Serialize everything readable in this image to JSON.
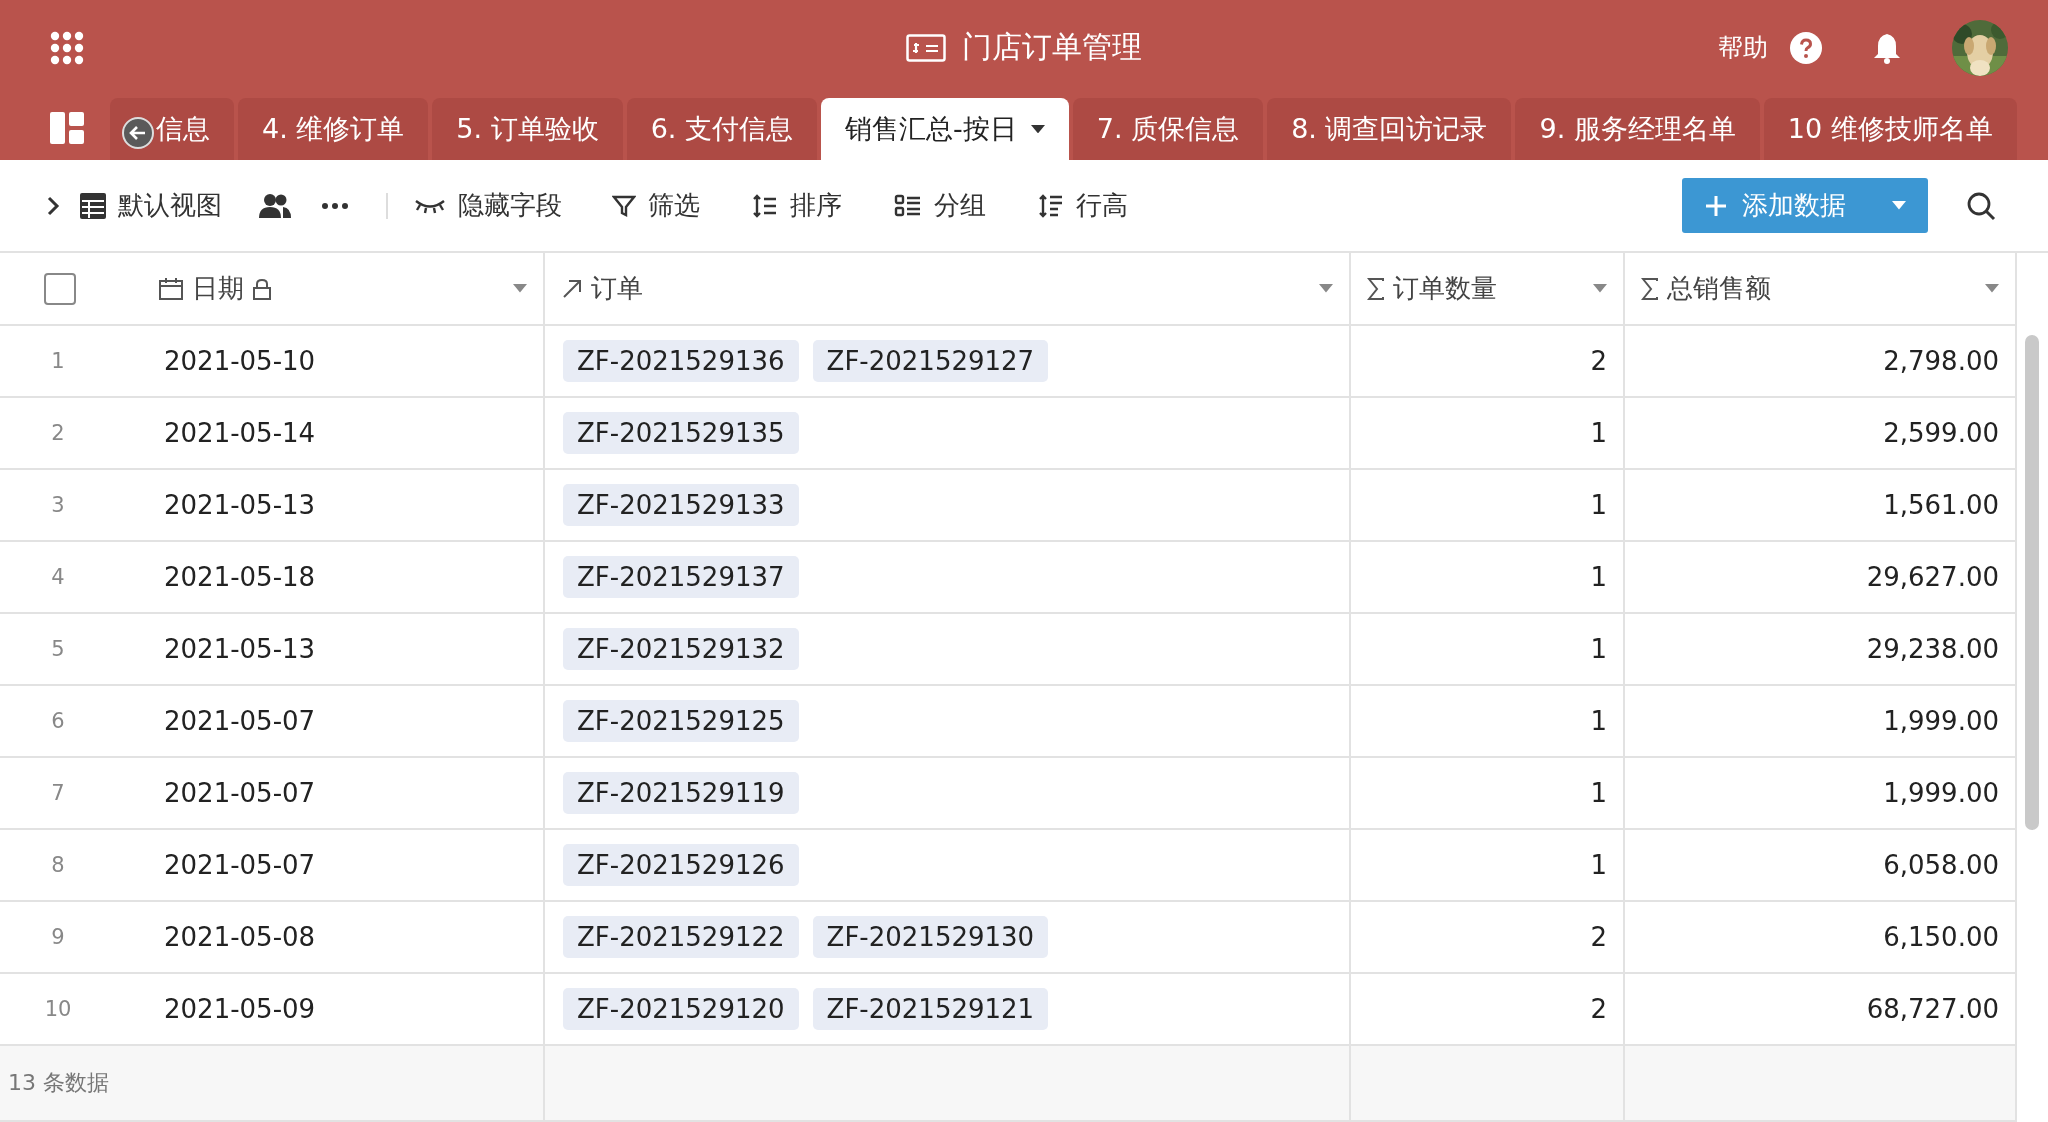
{
  "app": {
    "title": "门店订单管理",
    "help_label": "帮助"
  },
  "tabs": [
    {
      "label": "信息",
      "selected": false
    },
    {
      "label": "4. 维修订单",
      "selected": false
    },
    {
      "label": "5. 订单验收",
      "selected": false
    },
    {
      "label": "6. 支付信息",
      "selected": false
    },
    {
      "label": "销售汇总-按日",
      "selected": true
    },
    {
      "label": "7. 质保信息",
      "selected": false
    },
    {
      "label": "8. 调查回访记录",
      "selected": false
    },
    {
      "label": "9. 服务经理名单",
      "selected": false
    },
    {
      "label": "10 维修技师名单",
      "selected": false
    }
  ],
  "toolbar": {
    "view_label": "默认视图",
    "actions": [
      {
        "kind": "hide",
        "label": "隐藏字段"
      },
      {
        "kind": "filter",
        "label": "筛选"
      },
      {
        "kind": "sort",
        "label": "排序"
      },
      {
        "kind": "group",
        "label": "分组"
      },
      {
        "kind": "rowheight",
        "label": "行高"
      }
    ],
    "add_button": "添加数据"
  },
  "table": {
    "select_all": {
      "checked": false
    },
    "columns": [
      {
        "kind": "date",
        "label": "日期",
        "locked": true
      },
      {
        "kind": "link",
        "label": "订单",
        "locked": false
      },
      {
        "kind": "sum",
        "label": "订单数量",
        "locked": false
      },
      {
        "kind": "sum",
        "label": "总销售额",
        "locked": false
      }
    ],
    "rows": [
      {
        "index": "1",
        "date": "2021-05-10",
        "orders": [
          "ZF-2021529136",
          "ZF-2021529127"
        ],
        "count": "2",
        "total": "2,798.00"
      },
      {
        "index": "2",
        "date": "2021-05-14",
        "orders": [
          "ZF-2021529135"
        ],
        "count": "1",
        "total": "2,599.00"
      },
      {
        "index": "3",
        "date": "2021-05-13",
        "orders": [
          "ZF-2021529133"
        ],
        "count": "1",
        "total": "1,561.00"
      },
      {
        "index": "4",
        "date": "2021-05-18",
        "orders": [
          "ZF-2021529137"
        ],
        "count": "1",
        "total": "29,627.00"
      },
      {
        "index": "5",
        "date": "2021-05-13",
        "orders": [
          "ZF-2021529132"
        ],
        "count": "1",
        "total": "29,238.00"
      },
      {
        "index": "6",
        "date": "2021-05-07",
        "orders": [
          "ZF-2021529125"
        ],
        "count": "1",
        "total": "1,999.00"
      },
      {
        "index": "7",
        "date": "2021-05-07",
        "orders": [
          "ZF-2021529119"
        ],
        "count": "1",
        "total": "1,999.00"
      },
      {
        "index": "8",
        "date": "2021-05-07",
        "orders": [
          "ZF-2021529126"
        ],
        "count": "1",
        "total": "6,058.00"
      },
      {
        "index": "9",
        "date": "2021-05-08",
        "orders": [
          "ZF-2021529122",
          "ZF-2021529130"
        ],
        "count": "2",
        "total": "6,150.00"
      },
      {
        "index": "10",
        "date": "2021-05-09",
        "orders": [
          "ZF-2021529120",
          "ZF-2021529121"
        ],
        "count": "2",
        "total": "68,727.00"
      }
    ],
    "footer": "13 条数据"
  }
}
